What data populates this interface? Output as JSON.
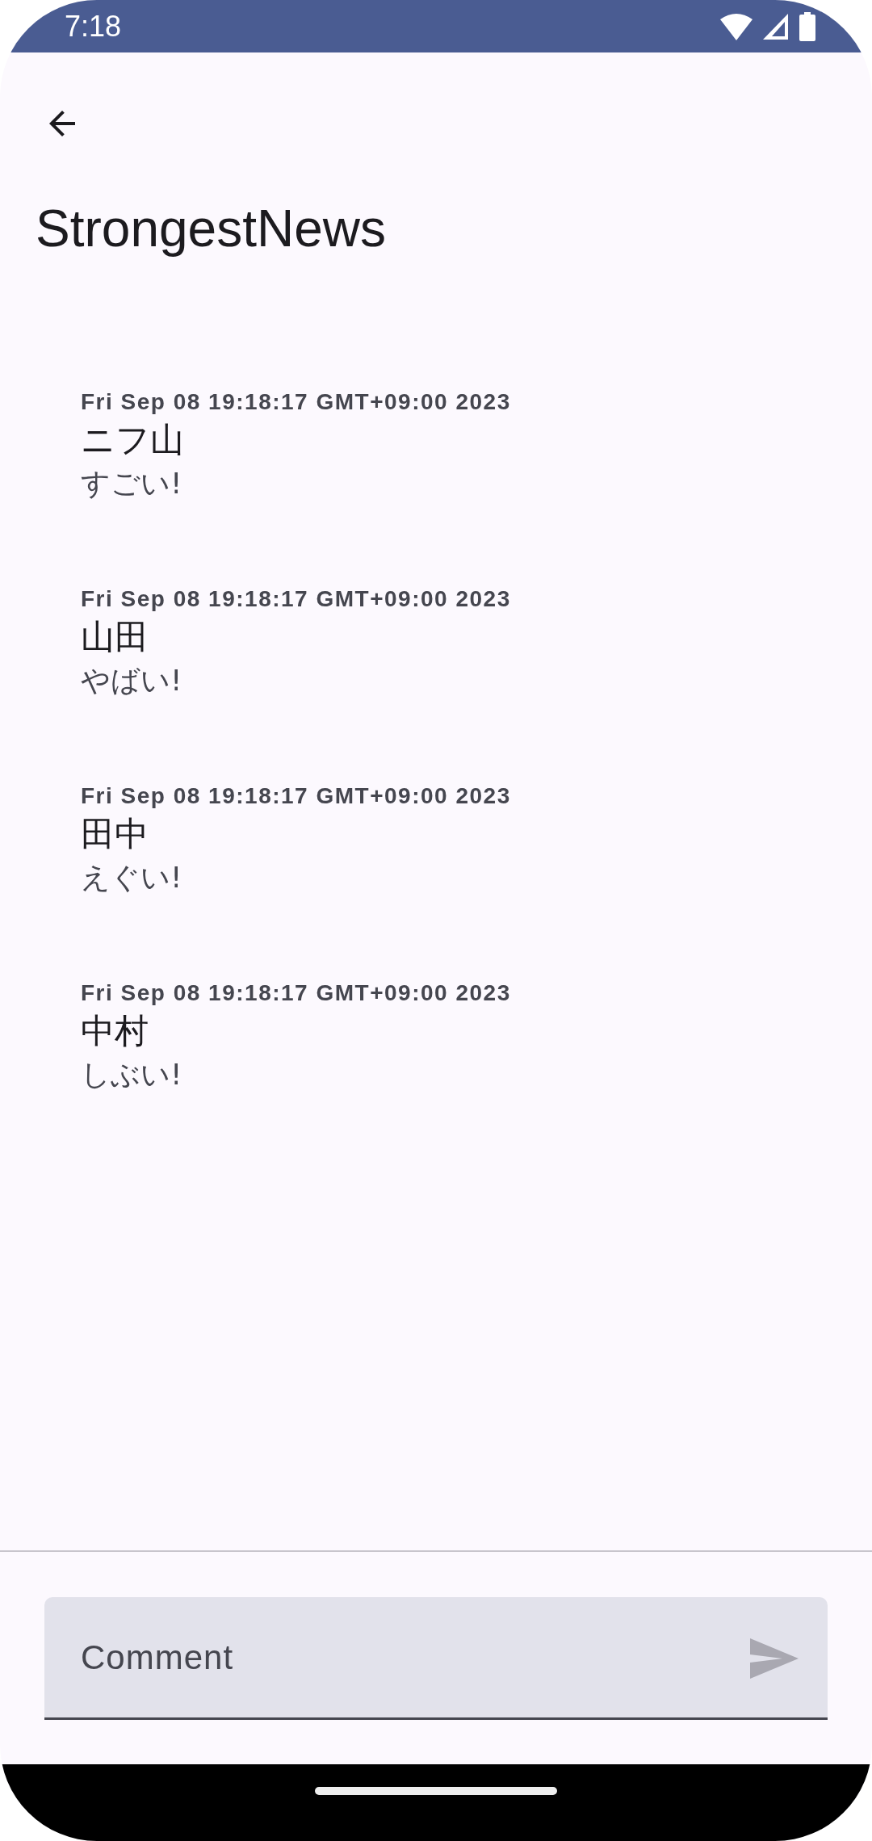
{
  "status_bar": {
    "time": "7:18"
  },
  "app_bar": {
    "title": "StrongestNews"
  },
  "comments": [
    {
      "date": "Fri Sep 08 19:18:17 GMT+09:00 2023",
      "author": "ニフ山",
      "text": "すごい!"
    },
    {
      "date": "Fri Sep 08 19:18:17 GMT+09:00 2023",
      "author": "山田",
      "text": "やばい!"
    },
    {
      "date": "Fri Sep 08 19:18:17 GMT+09:00 2023",
      "author": "田中",
      "text": "えぐい!"
    },
    {
      "date": "Fri Sep 08 19:18:17 GMT+09:00 2023",
      "author": "中村",
      "text": "しぶい!"
    }
  ],
  "comment_field": {
    "placeholder": "Comment"
  }
}
